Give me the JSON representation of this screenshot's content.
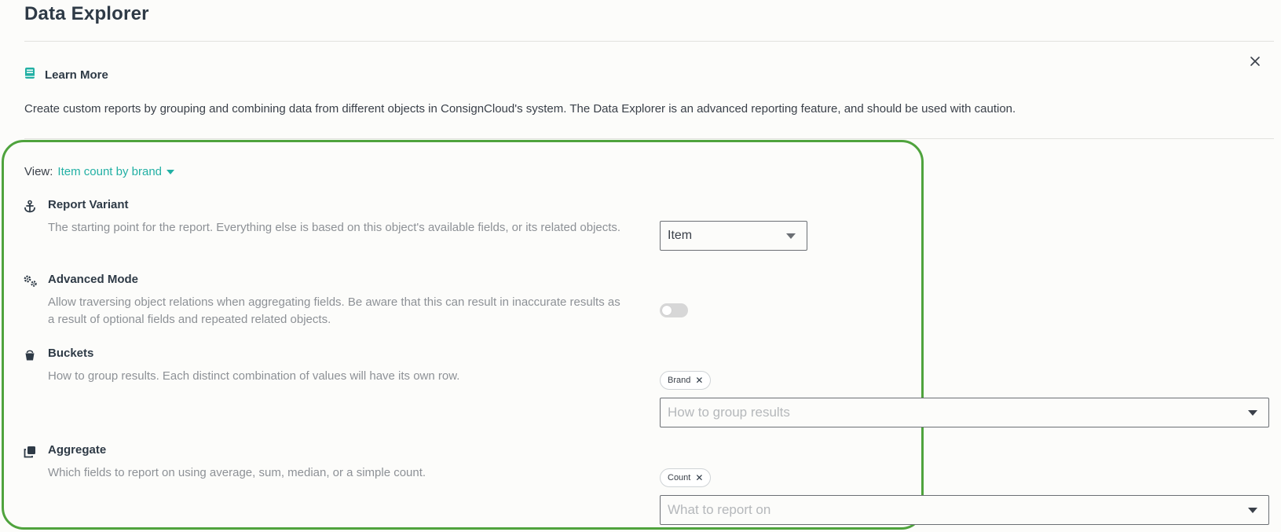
{
  "header": {
    "title": "Data Explorer"
  },
  "learn_more": {
    "label": "Learn More",
    "icon": "book-icon"
  },
  "intro": "Create custom reports by grouping and combining data from different objects in ConsignCloud's system. The Data Explorer is an advanced reporting feature, and should be used with caution.",
  "view": {
    "label": "View:",
    "selected": "Item count by brand"
  },
  "sections": {
    "report_variant": {
      "title": "Report Variant",
      "description": "The starting point for the report. Everything else is based on this object's available fields, or its related objects.",
      "value": "Item",
      "icon": "anchor-icon"
    },
    "advanced_mode": {
      "title": "Advanced Mode",
      "description": "Allow traversing object relations when aggregating fields. Be aware that this can result in inaccurate results as a result of optional fields and repeated related objects.",
      "enabled": false,
      "icon": "gears-icon"
    },
    "buckets": {
      "title": "Buckets",
      "description": "How to group results. Each distinct combination of values will have its own row.",
      "chip": "Brand",
      "placeholder": "How to group results",
      "icon": "bucket-icon"
    },
    "aggregate": {
      "title": "Aggregate",
      "description": "Which fields to report on using average, sum, median, or a simple count.",
      "chip": "Count",
      "placeholder": "What to report on",
      "icon": "copy-icon"
    }
  },
  "colors": {
    "accent": "#22b0a4",
    "highlight_border": "#4fa33d",
    "title": "#2e3a46",
    "muted": "#8d9196"
  }
}
